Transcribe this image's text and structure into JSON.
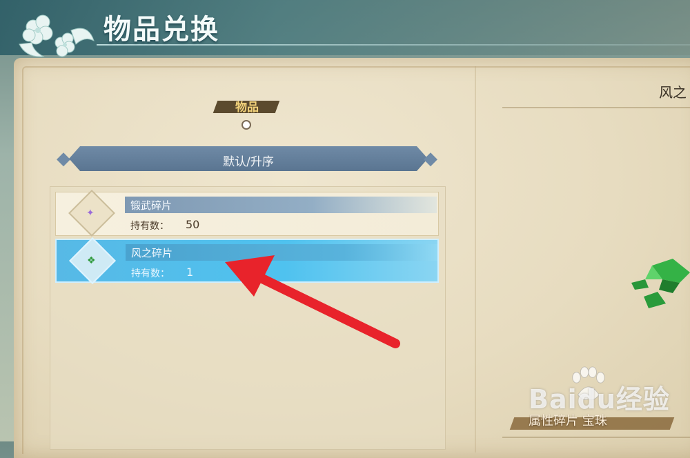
{
  "header": {
    "title": "物品兑换"
  },
  "category": {
    "label": "物品"
  },
  "sort": {
    "label": "默认/升序"
  },
  "items": [
    {
      "name": "锻武碎片",
      "qty_label": "持有数：",
      "qty": "50",
      "selected": false
    },
    {
      "name": "风之碎片",
      "qty_label": "持有数：",
      "qty": "1",
      "selected": true
    }
  ],
  "detail": {
    "title": "风之",
    "tag": "属性碎片 宝珠"
  },
  "watermark": {
    "text": "Baidu经验"
  },
  "colors": {
    "accent_selected": "#4fc2ef",
    "arrow": "#e8232b",
    "header_text": "#f4fbfa"
  },
  "icons": {
    "header_emblem": "flower-emblem-icon",
    "item_gem_1": "purple-gem-icon",
    "item_gem_2": "green-gem-icon"
  }
}
